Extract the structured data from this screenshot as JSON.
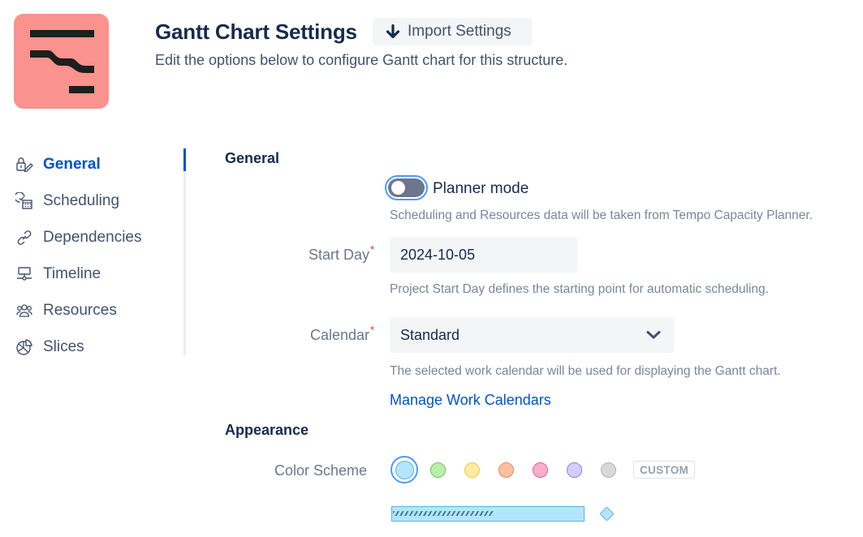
{
  "header": {
    "title": "Gantt Chart Settings",
    "import_button": "Import Settings",
    "import_icon": "arrow-down-icon",
    "subtitle": "Edit the options below to configure Gantt chart for this structure.",
    "logo_color": "#fa928e"
  },
  "sidebar": {
    "active_index": 0,
    "items": [
      {
        "label": "General",
        "icon": "lock-edit-icon",
        "active": true
      },
      {
        "label": "Scheduling",
        "icon": "clock-calendar-icon",
        "active": false
      },
      {
        "label": "Dependencies",
        "icon": "link-icon",
        "active": false
      },
      {
        "label": "Timeline",
        "icon": "timeline-icon",
        "active": false
      },
      {
        "label": "Resources",
        "icon": "people-icon",
        "active": false
      },
      {
        "label": "Slices",
        "icon": "pie-slices-icon",
        "active": false
      }
    ]
  },
  "general": {
    "heading": "General",
    "planner_mode": {
      "label": "Planner mode",
      "enabled": false,
      "help": "Scheduling and Resources data will be taken from Tempo Capacity Planner."
    },
    "start_day": {
      "label": "Start Day",
      "required": "*",
      "value": "2024-10-05",
      "help": "Project Start Day defines the starting point for automatic scheduling."
    },
    "calendar": {
      "label": "Calendar",
      "required": "*",
      "value": "Standard",
      "help": "The selected work calendar will be used for displaying the Gantt chart.",
      "manage_link": "Manage Work Calendars"
    }
  },
  "appearance": {
    "heading": "Appearance",
    "color_scheme": {
      "label": "Color Scheme",
      "selected_index": 0,
      "swatches": [
        {
          "name": "blue",
          "fill": "#b3e5fc",
          "border": "#5eb3dd"
        },
        {
          "name": "green",
          "fill": "#b9f0a8",
          "border": "#6cc45a"
        },
        {
          "name": "yellow",
          "fill": "#ffeb9c",
          "border": "#e6c65a"
        },
        {
          "name": "orange",
          "fill": "#ffc09f",
          "border": "#e08a5e"
        },
        {
          "name": "pink",
          "fill": "#ffadc9",
          "border": "#d9648c"
        },
        {
          "name": "purple",
          "fill": "#d5ccff",
          "border": "#8f7fe0"
        },
        {
          "name": "gray",
          "fill": "#d9d9d9",
          "border": "#b3b3b3"
        }
      ],
      "custom_button": "CUSTOM"
    },
    "preview": {
      "progress_fraction": 0.53
    }
  },
  "colors": {
    "accent": "#0052cc",
    "focus": "#4c9aff",
    "required": "#de350b"
  }
}
